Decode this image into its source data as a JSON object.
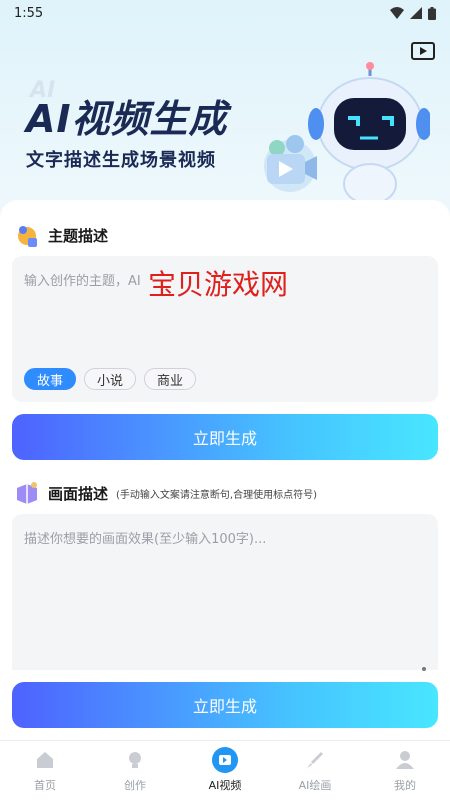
{
  "status": {
    "time": "1:55"
  },
  "hero": {
    "ghost": "AI",
    "title": "AI视频生成",
    "subtitle": "文字描述生成场景视频"
  },
  "topic": {
    "title": "主题描述",
    "placeholder": "输入创作的主题，AI",
    "chips": [
      "故事",
      "小说",
      "商业"
    ],
    "active_chip": "故事"
  },
  "watermark": "宝贝游戏网",
  "generate_label": "立即生成",
  "scene": {
    "title": "画面描述",
    "hint": "(手动输入文案请注意断句,合理使用标点符号)",
    "placeholder": "描述你想要的画面效果(至少输入100字)..."
  },
  "tabs": [
    {
      "label": "首页",
      "icon": "home-icon"
    },
    {
      "label": "创作",
      "icon": "bulb-icon"
    },
    {
      "label": "AI视频",
      "icon": "video-icon"
    },
    {
      "label": "AI绘画",
      "icon": "brush-icon"
    },
    {
      "label": "我的",
      "icon": "user-icon"
    }
  ],
  "active_tab": "AI视频",
  "colors": {
    "accent": "#2f8cff",
    "title": "#1b2a55",
    "tab_active": "#2196f3"
  }
}
